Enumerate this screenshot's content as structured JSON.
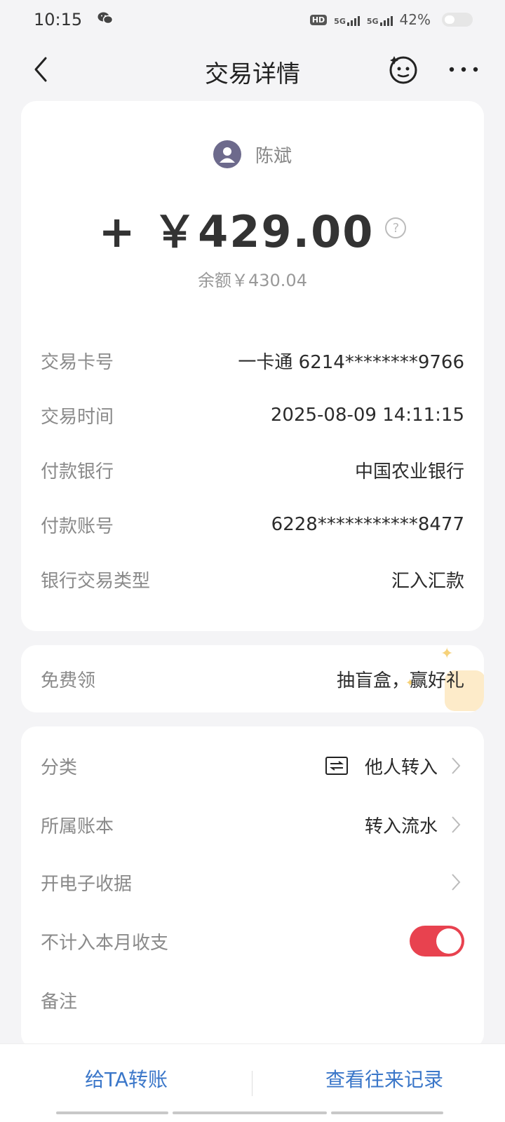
{
  "status_bar": {
    "time": "10:15",
    "battery": "42%",
    "hd_label": "HD",
    "net1": "5G",
    "net2": "5G"
  },
  "header": {
    "title": "交易详情",
    "back_icon": "chevron-left-icon",
    "robot_icon": "robot-face-icon",
    "more_icon": "more-dots-icon"
  },
  "transaction": {
    "payer_name": "陈斌",
    "amount": "+ ￥429.00",
    "help_glyph": "?",
    "balance": "余额￥430.04",
    "details": [
      {
        "label": "交易卡号",
        "value": "一卡通 6214********9766"
      },
      {
        "label": "交易时间",
        "value": "2025-08-09 14:11:15"
      },
      {
        "label": "付款银行",
        "value": "中国农业银行"
      },
      {
        "label": "付款账号",
        "value": "6228***********8477"
      },
      {
        "label": "银行交易类型",
        "value": "汇入汇款"
      }
    ]
  },
  "promo": {
    "label": "免费领",
    "value": "抽盲盒，赢好礼"
  },
  "settings": {
    "category": {
      "label": "分类",
      "value": "他人转入"
    },
    "ledger": {
      "label": "所属账本",
      "value": "转入流水"
    },
    "receipt": {
      "label": "开电子收据"
    },
    "exclude": {
      "label": "不计入本月收支",
      "enabled": true
    },
    "note": {
      "label": "备注"
    }
  },
  "bottom": {
    "transfer_label": "给TA转账",
    "history_label": "查看往来记录"
  },
  "colors": {
    "accent_blue": "#3b77c9",
    "toggle_on": "#e8424f",
    "avatar": "#6d6a8c"
  }
}
